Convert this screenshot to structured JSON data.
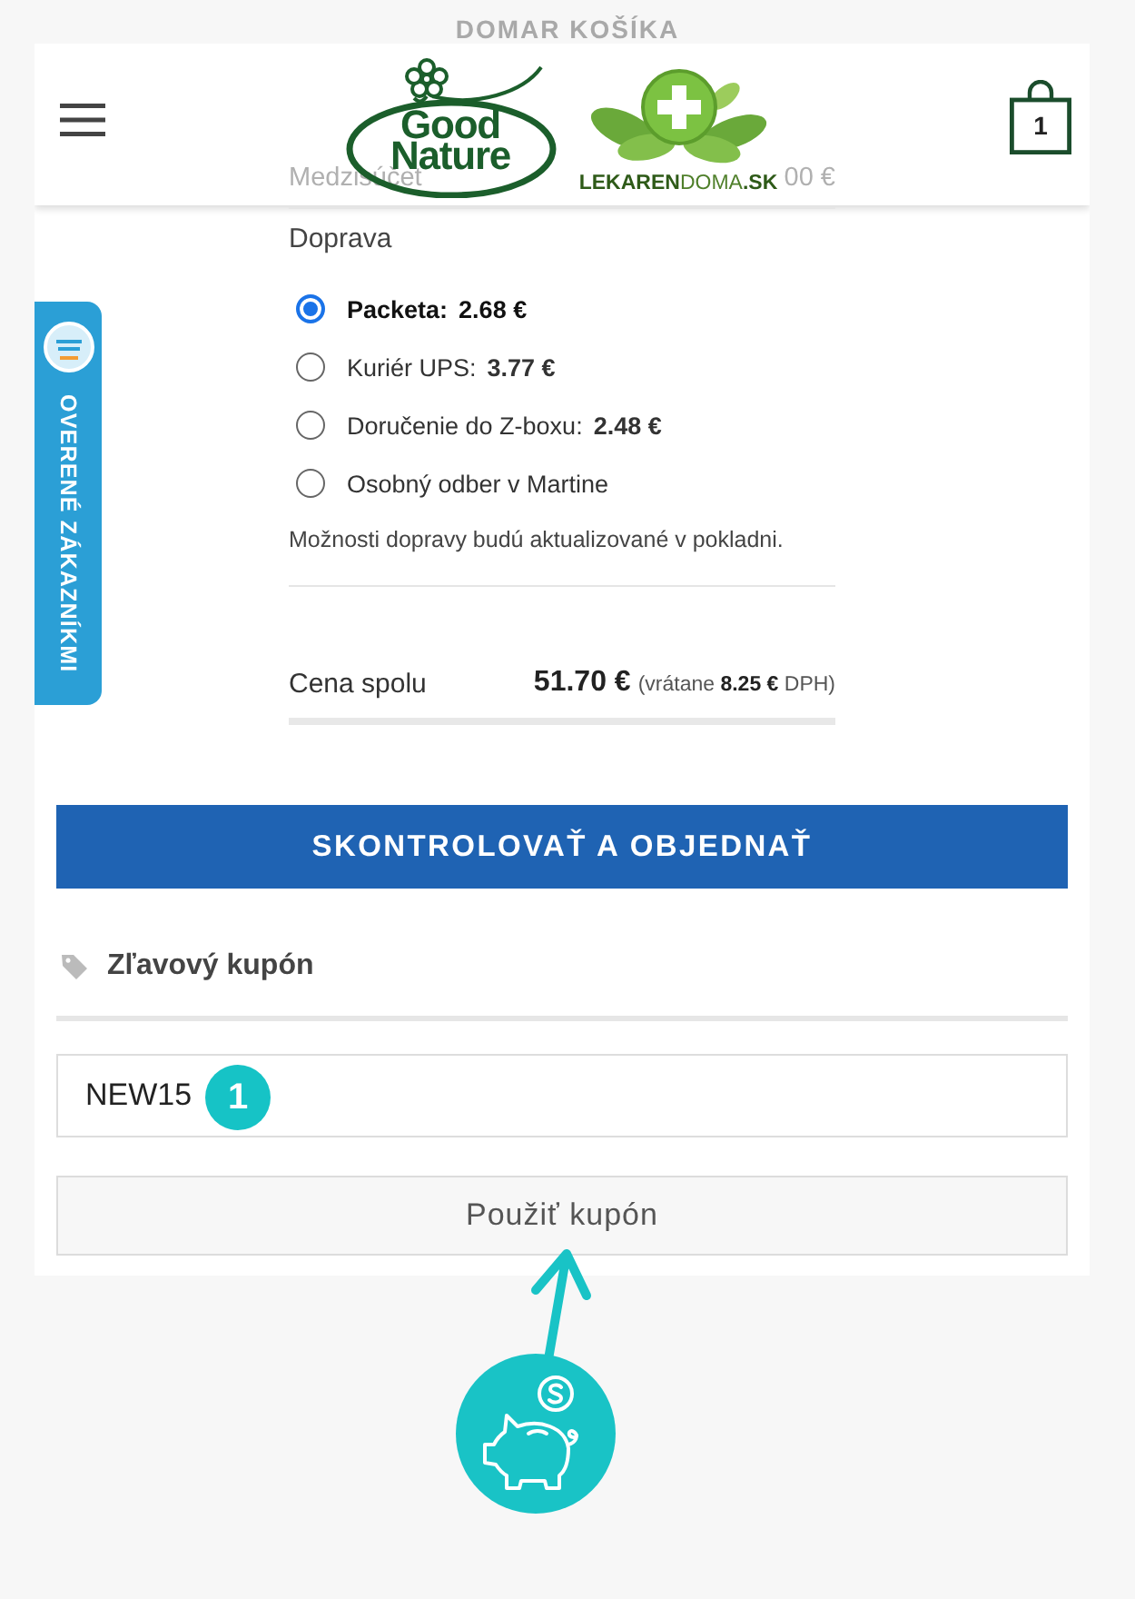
{
  "header": {
    "logos": [
      {
        "kind": "good-nature",
        "text": "Good Nature"
      },
      {
        "kind": "pharmacy",
        "text": "**LEKAREN**DOMA**.SK**"
      }
    ],
    "cart_count": "1"
  },
  "cart_heading": "DOMAR KOŠÍKA",
  "subtotal": {
    "label": "Medzisúčet",
    "value": "00 €"
  },
  "shipping": {
    "title": "Doprava",
    "options": [
      {
        "name": "Packeta:",
        "price": "2.68 €",
        "selected": true
      },
      {
        "name": "Kuriér UPS:",
        "price": "3.77 €",
        "selected": false
      },
      {
        "name": "Doručenie do Z-boxu:",
        "price": "2.48 €",
        "selected": false
      },
      {
        "name": "Osobný odber v Martine",
        "selected": false
      }
    ],
    "note": "Možnosti dopravy budú aktualizované v pokladni."
  },
  "total": {
    "label": "Cena spolu",
    "price": "51.70 €",
    "tax_note": "(vrátane **8.25 €** DPH)"
  },
  "side_tab": {
    "label": "OVERENÉ ZÁKAZNÍKMI"
  },
  "checkout_button": "SKONTROLOVAŤ A OBJEDNAŤ",
  "coupon": {
    "title": "Zľavový kupón",
    "value": "NEW15",
    "button": "Použiť kupón"
  },
  "annotation": {
    "step": "1"
  }
}
